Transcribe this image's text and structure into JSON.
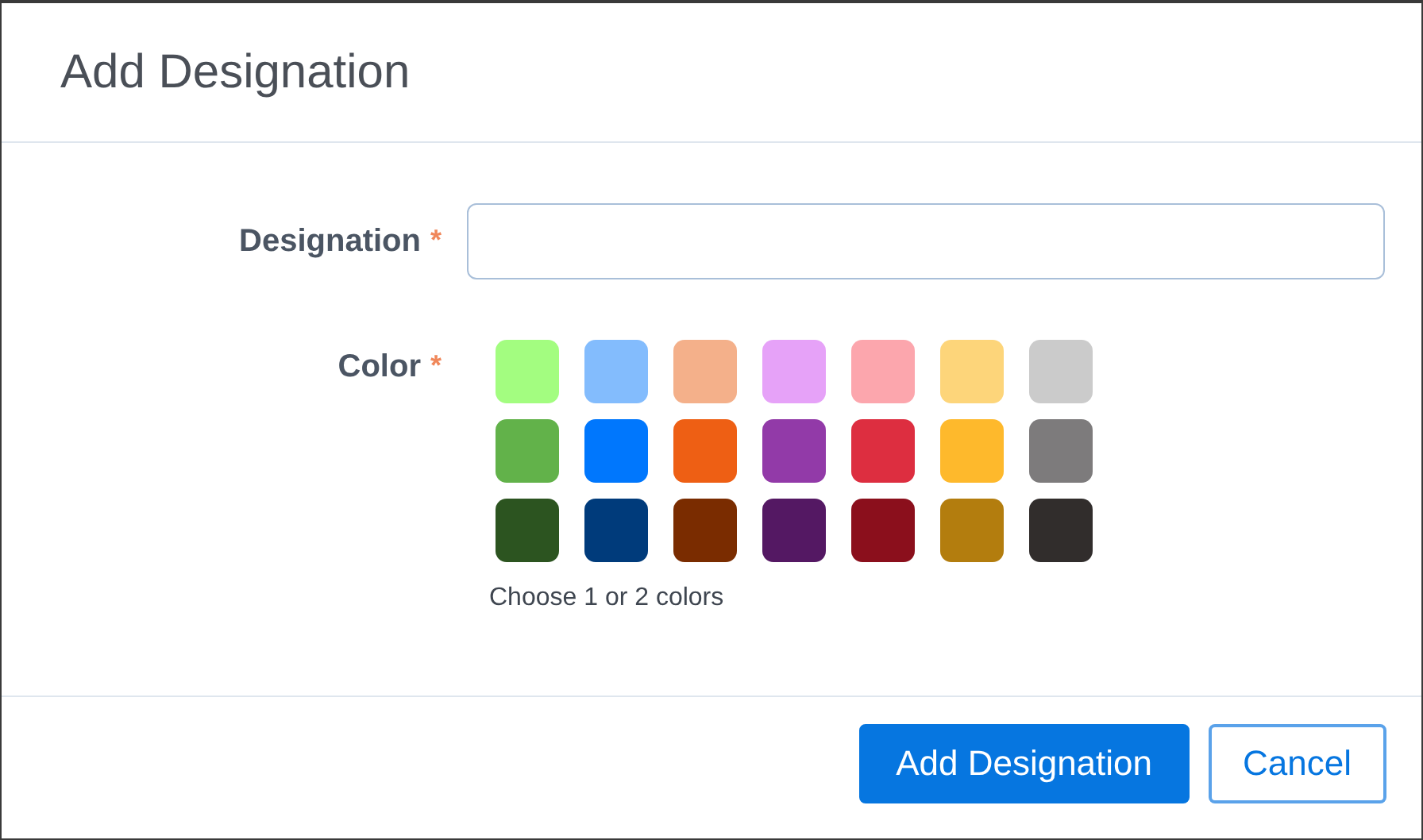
{
  "dialog": {
    "title": "Add Designation"
  },
  "designation_field": {
    "label": "Designation",
    "required_mark": "*"
  },
  "color_field": {
    "label": "Color",
    "required_mark": "*",
    "hint": "Choose 1 or 2 colors",
    "swatches": [
      {
        "color": "#a3fd80",
        "selected": false
      },
      {
        "color": "#83bcfd",
        "selected": false
      },
      {
        "color": "#f4b08a",
        "selected": false
      },
      {
        "color": "#e6a2f8",
        "selected": false
      },
      {
        "color": "#fca6ad",
        "selected": false
      },
      {
        "color": "#fdd57a",
        "selected": false
      },
      {
        "color": "#cbcbcb",
        "selected": false
      },
      {
        "color": "#62b24a",
        "selected": false
      },
      {
        "color": "#0077fd",
        "selected": false
      },
      {
        "color": "#ee5f14",
        "selected": false
      },
      {
        "color": "#923aa8",
        "selected": false
      },
      {
        "color": "#dd2e40",
        "selected": false
      },
      {
        "color": "#feb92c",
        "selected": false
      },
      {
        "color": "#7d7b7c",
        "selected": false
      },
      {
        "color": "#2c5420",
        "selected": false
      },
      {
        "color": "#003b7b",
        "selected": false
      },
      {
        "color": "#7a2c00",
        "selected": false
      },
      {
        "color": "#541863",
        "selected": false
      },
      {
        "color": "#8b0f1c",
        "selected": false
      },
      {
        "color": "#b37d0e",
        "selected": false
      },
      {
        "color": "#312d2c",
        "selected": false
      }
    ]
  },
  "buttons": [
    {
      "label": "Add Designation",
      "kind": "primary"
    },
    {
      "label": "Cancel",
      "kind": "secondary"
    }
  ]
}
